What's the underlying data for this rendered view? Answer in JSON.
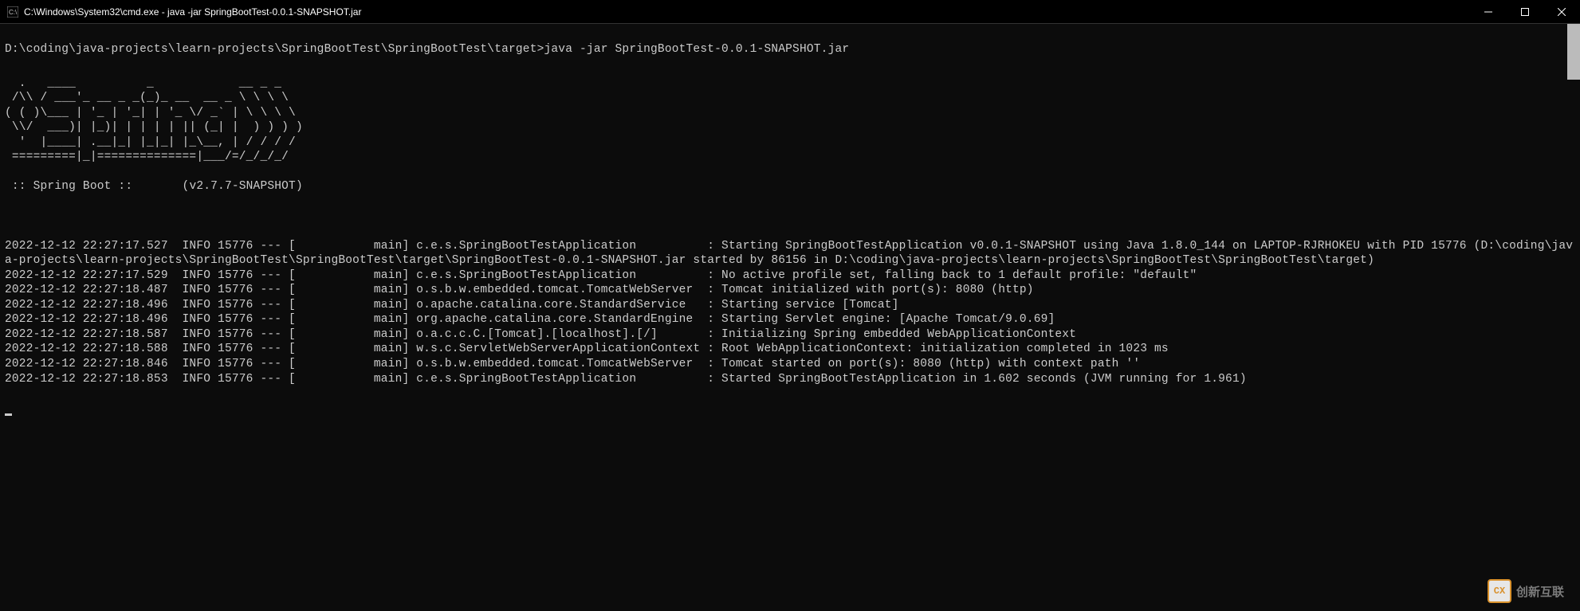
{
  "titlebar": {
    "icon": "cmd-icon",
    "text": "C:\\Windows\\System32\\cmd.exe - java  -jar SpringBootTest-0.0.1-SNAPSHOT.jar"
  },
  "prompt": "D:\\coding\\java-projects\\learn-projects\\SpringBootTest\\SpringBootTest\\target>java -jar SpringBootTest-0.0.1-SNAPSHOT.jar",
  "ascii_art": "  .   ____          _            __ _ _\n /\\\\ / ___'_ __ _ _(_)_ __  __ _ \\ \\ \\ \\\n( ( )\\___ | '_ | '_| | '_ \\/ _` | \\ \\ \\ \\\n \\\\/  ___)| |_)| | | | | || (_| |  ) ) ) )\n  '  |____| .__|_| |_|_| |_\\__, | / / / /\n =========|_|==============|___/=/_/_/_/",
  "banner_line": " :: Spring Boot ::       (v2.7.7-SNAPSHOT)",
  "log_lines": [
    "2022-12-12 22:27:17.527  INFO 15776 --- [           main] c.e.s.SpringBootTestApplication          : Starting SpringBootTestApplication v0.0.1-SNAPSHOT using Java 1.8.0_144 on LAPTOP-RJRHOKEU with PID 15776 (D:\\coding\\java-projects\\learn-projects\\SpringBootTest\\SpringBootTest\\target\\SpringBootTest-0.0.1-SNAPSHOT.jar started by 86156 in D:\\coding\\java-projects\\learn-projects\\SpringBootTest\\SpringBootTest\\target)",
    "2022-12-12 22:27:17.529  INFO 15776 --- [           main] c.e.s.SpringBootTestApplication          : No active profile set, falling back to 1 default profile: \"default\"",
    "2022-12-12 22:27:18.487  INFO 15776 --- [           main] o.s.b.w.embedded.tomcat.TomcatWebServer  : Tomcat initialized with port(s): 8080 (http)",
    "2022-12-12 22:27:18.496  INFO 15776 --- [           main] o.apache.catalina.core.StandardService   : Starting service [Tomcat]",
    "2022-12-12 22:27:18.496  INFO 15776 --- [           main] org.apache.catalina.core.StandardEngine  : Starting Servlet engine: [Apache Tomcat/9.0.69]",
    "2022-12-12 22:27:18.587  INFO 15776 --- [           main] o.a.c.c.C.[Tomcat].[localhost].[/]       : Initializing Spring embedded WebApplicationContext",
    "2022-12-12 22:27:18.588  INFO 15776 --- [           main] w.s.c.ServletWebServerApplicationContext : Root WebApplicationContext: initialization completed in 1023 ms",
    "2022-12-12 22:27:18.846  INFO 15776 --- [           main] o.s.b.w.embedded.tomcat.TomcatWebServer  : Tomcat started on port(s): 8080 (http) with context path ''",
    "2022-12-12 22:27:18.853  INFO 15776 --- [           main] c.e.s.SpringBootTestApplication          : Started SpringBootTestApplication in 1.602 seconds (JVM running for 1.961)"
  ],
  "watermark": {
    "logo": "CX",
    "text": "创新互联"
  }
}
